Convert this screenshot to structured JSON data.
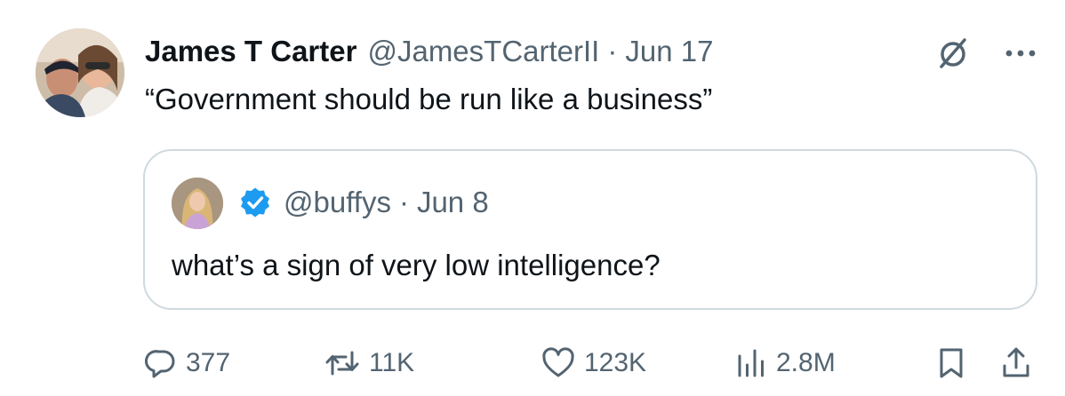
{
  "tweet": {
    "author_name": "James T Carter",
    "author_handle": "@JamesTCarterII",
    "separator": "·",
    "date": "Jun 17",
    "text": "“Government should be run like a business”"
  },
  "quoted_tweet": {
    "handle": "@buffys",
    "separator": "·",
    "date": "Jun 8",
    "text": "what’s a sign of very low intelligence?",
    "verified": true
  },
  "actions": {
    "replies": "377",
    "reposts": "11K",
    "likes": "123K",
    "views": "2.8M"
  },
  "icons": {
    "top": [
      "grok-icon",
      "more-icon"
    ],
    "actions": [
      "reply-icon",
      "repost-icon",
      "like-icon",
      "views-icon",
      "bookmark-icon",
      "share-icon"
    ]
  },
  "colors": {
    "text": "#0f1419",
    "secondary": "#536471",
    "border": "#cfd9de",
    "verified": "#1d9bf0"
  }
}
